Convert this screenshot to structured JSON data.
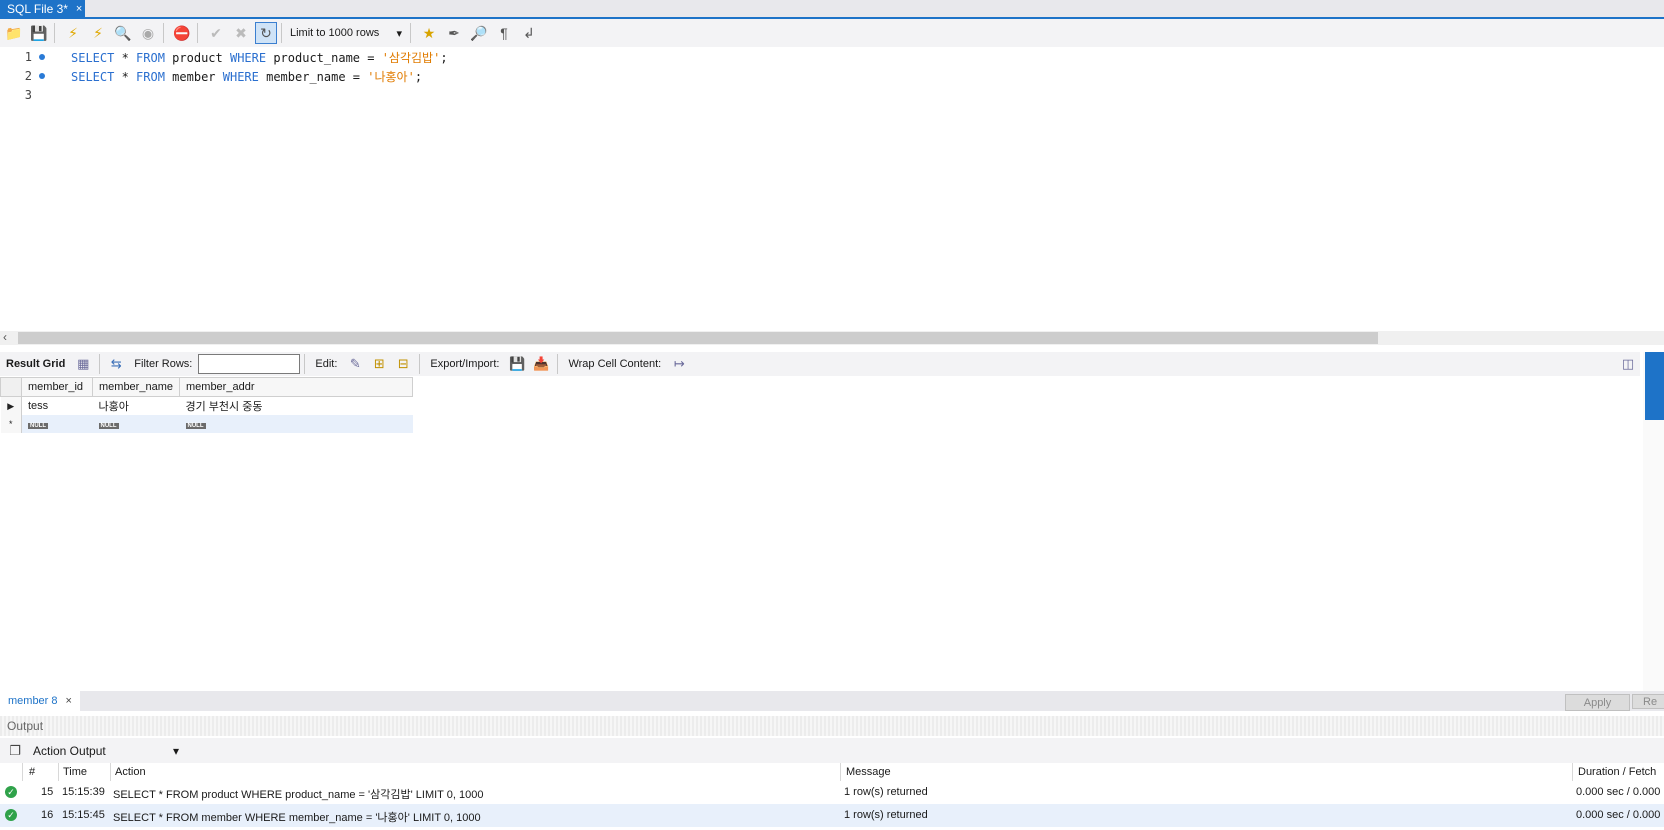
{
  "tabs": [
    {
      "label": "SQL File 3*",
      "close": "×"
    }
  ],
  "toolbar": {
    "limit_select": "Limit to 1000 rows",
    "buttons": [
      "open-file",
      "save",
      "execute",
      "execute-current",
      "explain",
      "stop",
      "toggle-stop-on-error",
      "commit",
      "rollback",
      "autocommit",
      "limit",
      "add-snippet",
      "beautify",
      "find",
      "invisible-chars",
      "wrap"
    ]
  },
  "editor": {
    "lines": [
      {
        "num": "1",
        "pre": "SELECT",
        "mid1": " * ",
        "kw2": "FROM",
        "t1": " product ",
        "kw3": "WHERE",
        "t2": " product_name = ",
        "str": "'삼각김밥'",
        "end": ";"
      },
      {
        "num": "2",
        "pre": "SELECT",
        "mid1": " * ",
        "kw2": "FROM",
        "t1": " member ",
        "kw3": "WHERE",
        "t2": " member_name = ",
        "str": "'나홍아'",
        "end": ";"
      },
      {
        "num": "3"
      }
    ]
  },
  "result_toolbar": {
    "result_grid": "Result Grid",
    "filter_rows": "Filter Rows:",
    "edit": "Edit:",
    "export_import": "Export/Import:",
    "wrap_cell": "Wrap Cell Content:"
  },
  "grid": {
    "columns": [
      "member_id",
      "member_name",
      "member_addr"
    ],
    "rows": [
      [
        "tess",
        "나홍아",
        "경기 부천시 중동"
      ]
    ],
    "null_label": "NULL",
    "new_row_marker": "*"
  },
  "result_tabs": {
    "label": "member 8",
    "close": "×",
    "apply": "Apply",
    "revert": "Re"
  },
  "output": {
    "title": "Output",
    "selector": "Action Output",
    "columns": {
      "num": "#",
      "time": "Time",
      "action": "Action",
      "message": "Message",
      "duration": "Duration / Fetch"
    },
    "rows": [
      {
        "num": "15",
        "time": "15:15:39",
        "action": "SELECT * FROM product WHERE product_name = '삼각김밥' LIMIT 0, 1000",
        "message": "1 row(s) returned",
        "duration": "0.000 sec / 0.000"
      },
      {
        "num": "16",
        "time": "15:15:45",
        "action": "SELECT * FROM member WHERE member_name = '나홍아' LIMIT 0, 1000",
        "message": "1 row(s) returned",
        "duration": "0.000 sec / 0.000"
      }
    ]
  },
  "colors": {
    "accent": "#1e73c8",
    "keyword": "#2a6fcf",
    "string": "#e07b00",
    "ok": "#2fa24a"
  }
}
